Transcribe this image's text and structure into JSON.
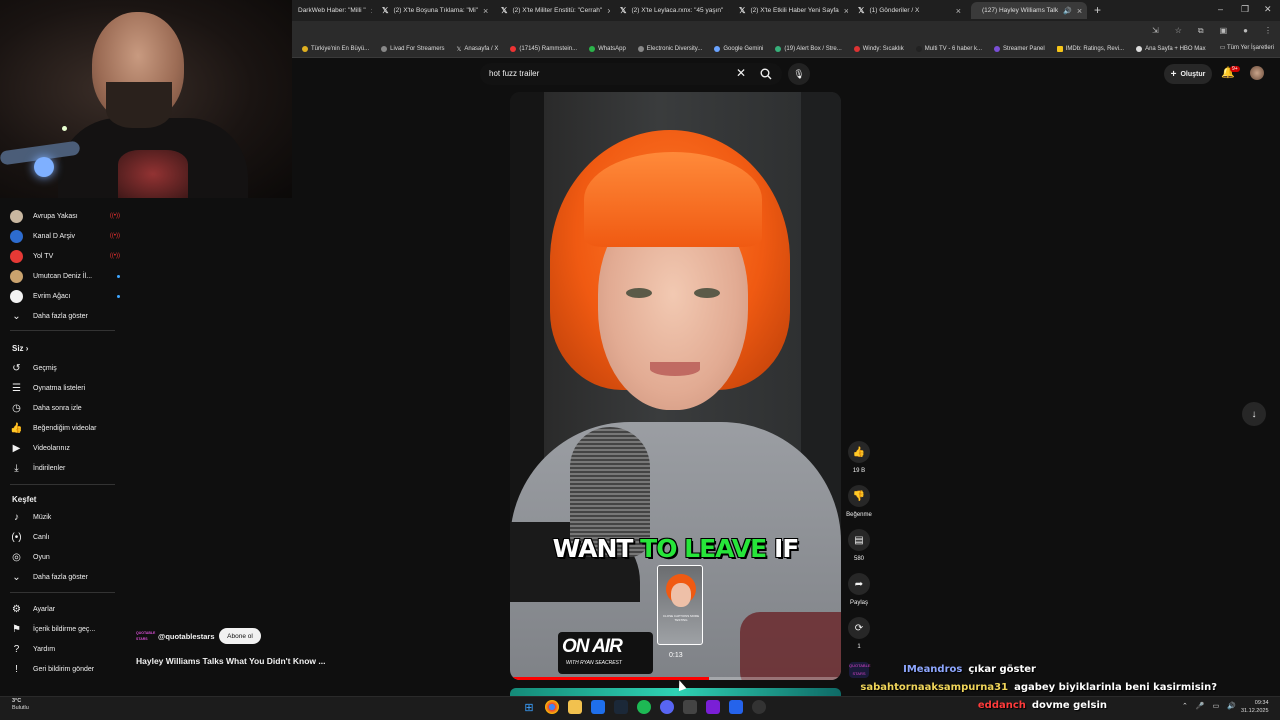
{
  "browser": {
    "tabs": [
      {
        "label": "DarkWeb Haber: \"Milli \"",
        "active": false
      },
      {
        "label": "(2) X'te Boşuna Tıklama: \"Mi\"",
        "active": false
      },
      {
        "label": "(2) X'te Militer Enstitü: \"Cerrah\"",
        "active": false
      },
      {
        "label": "(2) X'te Leylaca.rxnx: \"45 yaşın\"",
        "active": false
      },
      {
        "label": "(2) X'te Etkili Haber Yeni Sayfa",
        "active": false
      },
      {
        "label": "(1) Gönderiler / X",
        "active": false
      },
      {
        "label": "(127) Hayley Williams Talk",
        "active": true
      }
    ],
    "new_tab": "+",
    "bookmarks": [
      "Türkiye'nin En Büyü...",
      "Livad For Streamers",
      "Anasayfa / X",
      "(17145) Rammstein...",
      "WhatsApp",
      "Electronic Diversity...",
      "Google Gemini",
      "(19) Alert Box / Stre...",
      "Windy: Sıcaklık",
      "Multi TV - 6 haber k...",
      "Streamer Panel",
      "IMDb: Ratings, Revi...",
      "Ana Sayfa + HBO Max"
    ],
    "bookmarks_all": "Tüm Yer İşaretleri"
  },
  "sidebar": {
    "subs": [
      {
        "label": "Avrupa Yakası",
        "color": "#c9b7a0",
        "badge": "live"
      },
      {
        "label": "Kanal D Arşiv",
        "color": "#2d6ccf",
        "badge": "live"
      },
      {
        "label": "Yol TV",
        "color": "#e53935",
        "badge": "live"
      },
      {
        "label": "Umutcan Deniz İl...",
        "color": "#caa36e",
        "badge": "dot"
      },
      {
        "label": "Evrim Ağacı",
        "color": "#f2f2f2",
        "badge": "dot"
      }
    ],
    "show_more_1": "Daha fazla göster",
    "you_heading": "Siz",
    "you_items": [
      "Geçmiş",
      "Oynatma listeleri",
      "Daha sonra izle",
      "Beğendiğim videolar",
      "Videolarınız",
      "İndirilenler"
    ],
    "explore_heading": "Keşfet",
    "explore_items": [
      "Müzik",
      "Canlı",
      "Oyun"
    ],
    "show_more_2": "Daha fazla göster",
    "bottom_items": [
      "Ayarlar",
      "İçerik bildirme geç...",
      "Yardım",
      "Geri bildirim gönder"
    ]
  },
  "search": {
    "query": "hot fuzz trailer"
  },
  "header": {
    "create_label": "Oluştur",
    "notif_count": "9+"
  },
  "video": {
    "caption_white_1": "WANT",
    "caption_green": "TO LEAVE",
    "caption_white_2": "IF",
    "onair_title": "ON AIR",
    "onair_sub": "WITH RYAN SEACREST",
    "thumb_caption": "CLOSE CAPTIONS MORE TESTING",
    "thumb_time": "0:13",
    "progress": 0.6
  },
  "actions": {
    "like_count": "19 B",
    "dislike_label": "Beğenme",
    "comment_count": "580",
    "share_label": "Paylaş",
    "remix_count": "1",
    "channel_thumb": "QUOTABLE STARS"
  },
  "channel": {
    "logo_text": "QUOTABLE STARS",
    "name": "@quotablestars",
    "subscribe_label": "Abone ol",
    "video_title": "Hayley Williams Talks What You Didn't Know ..."
  },
  "chat": [
    {
      "user": "IMeandros",
      "msg": "çıkar göster",
      "color": "#8ea7ff"
    },
    {
      "user": "sabahtornaaksampurna31",
      "msg": "agabey biyiklarinla beni kasirmisin?",
      "color": "#f0d55a"
    },
    {
      "user": "eddanch",
      "msg": "dovme gelsin",
      "color": "#ff3b3b"
    }
  ],
  "taskbar": {
    "weather_temp": "3°C",
    "weather_desc": "Bulutlu",
    "time": "09:34",
    "date": "31.12.2025"
  }
}
